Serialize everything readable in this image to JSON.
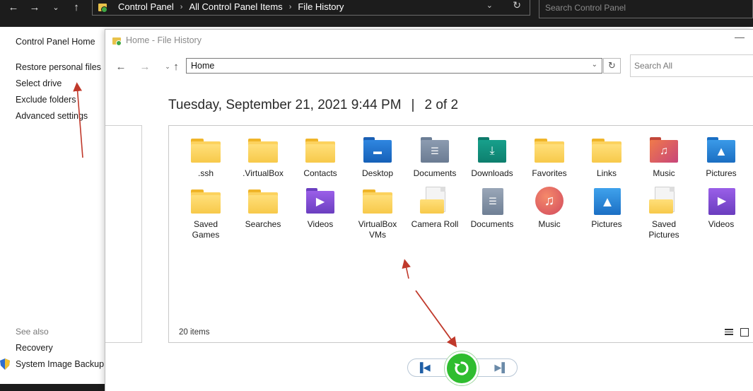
{
  "control_panel": {
    "breadcrumbs": [
      "Control Panel",
      "All Control Panel Items",
      "File History"
    ],
    "search_placeholder": "Search Control Panel",
    "sidebar": {
      "home": "Control Panel Home",
      "links": [
        "Restore personal files",
        "Select drive",
        "Exclude folders",
        "Advanced settings"
      ],
      "see_also_title": "See also",
      "see_also": [
        "Recovery",
        "System Image Backup"
      ]
    }
  },
  "file_history": {
    "window_title": "Home - File History",
    "address": "Home",
    "search_placeholder": "Search All",
    "backup_date": "Tuesday, September 21, 2021 9:44 PM",
    "divider": "|",
    "version": "2 of 2",
    "status": "20 items",
    "items": [
      {
        "label": ".ssh",
        "icon": "folder-icon"
      },
      {
        "label": ".VirtualBox",
        "icon": "folder-icon"
      },
      {
        "label": "Contacts",
        "icon": "folder-icon"
      },
      {
        "label": "Desktop",
        "icon": "desktop-folder-icon"
      },
      {
        "label": "Documents",
        "icon": "documents-folder-icon"
      },
      {
        "label": "Downloads",
        "icon": "downloads-folder-icon"
      },
      {
        "label": "Favorites",
        "icon": "folder-icon"
      },
      {
        "label": "Links",
        "icon": "folder-icon"
      },
      {
        "label": "Music",
        "icon": "music-folder-icon"
      },
      {
        "label": "Pictures",
        "icon": "pictures-folder-icon"
      },
      {
        "label": "Saved Games",
        "icon": "folder-icon"
      },
      {
        "label": "Searches",
        "icon": "folder-icon"
      },
      {
        "label": "Videos",
        "icon": "videos-folder-icon"
      },
      {
        "label": "VirtualBox VMs",
        "icon": "folder-icon"
      },
      {
        "label": "Camera Roll",
        "icon": "library-folder-icon"
      },
      {
        "label": "Documents",
        "icon": "documents-library-icon"
      },
      {
        "label": "Music",
        "icon": "music-library-icon"
      },
      {
        "label": "Pictures",
        "icon": "pictures-library-icon"
      },
      {
        "label": "Saved Pictures",
        "icon": "library-folder-icon"
      },
      {
        "label": "Videos",
        "icon": "videos-library-icon"
      }
    ],
    "controls": [
      "previous-version-button",
      "restore-button",
      "next-version-button"
    ]
  },
  "colors": {
    "folder": "#fcd25e",
    "restore_green": "#2fbd2f",
    "annotation_red": "#c0392b",
    "dark_chrome": "#1c1c1c"
  }
}
